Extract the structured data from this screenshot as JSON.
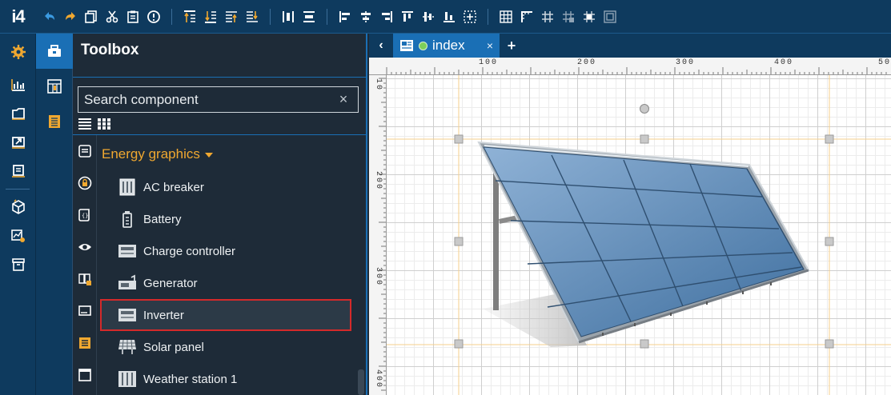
{
  "app": {
    "logo": "i4"
  },
  "toolbox": {
    "title": "Toolbox",
    "search_placeholder": "Search component",
    "clear_label": "×",
    "category": "Energy graphics",
    "components": [
      {
        "label": "AC breaker",
        "icon": "ac-breaker-icon"
      },
      {
        "label": "Battery",
        "icon": "battery-icon"
      },
      {
        "label": "Charge controller",
        "icon": "charge-controller-icon"
      },
      {
        "label": "Generator",
        "icon": "generator-icon"
      },
      {
        "label": "Inverter",
        "icon": "inverter-icon",
        "selected": true
      },
      {
        "label": "Solar panel",
        "icon": "solar-panel-icon"
      },
      {
        "label": "Weather station 1",
        "icon": "weather-station-icon"
      }
    ]
  },
  "editor": {
    "tab": {
      "label": "index",
      "close_label": "×"
    },
    "add_tab_label": "+",
    "prev_label": "‹",
    "ruler_top": [
      "100",
      "200",
      "300",
      "400",
      "50"
    ],
    "ruler_left": [
      "10",
      "200",
      "300",
      "400"
    ]
  },
  "colors": {
    "topbar": "#0e3a5e",
    "accent": "#1a6fb5",
    "category": "#f0a830",
    "selection": "#d42a2a",
    "toolbar_icon_undo": "#3b9ae1",
    "toolbar_icon_redo": "#f0a830"
  }
}
